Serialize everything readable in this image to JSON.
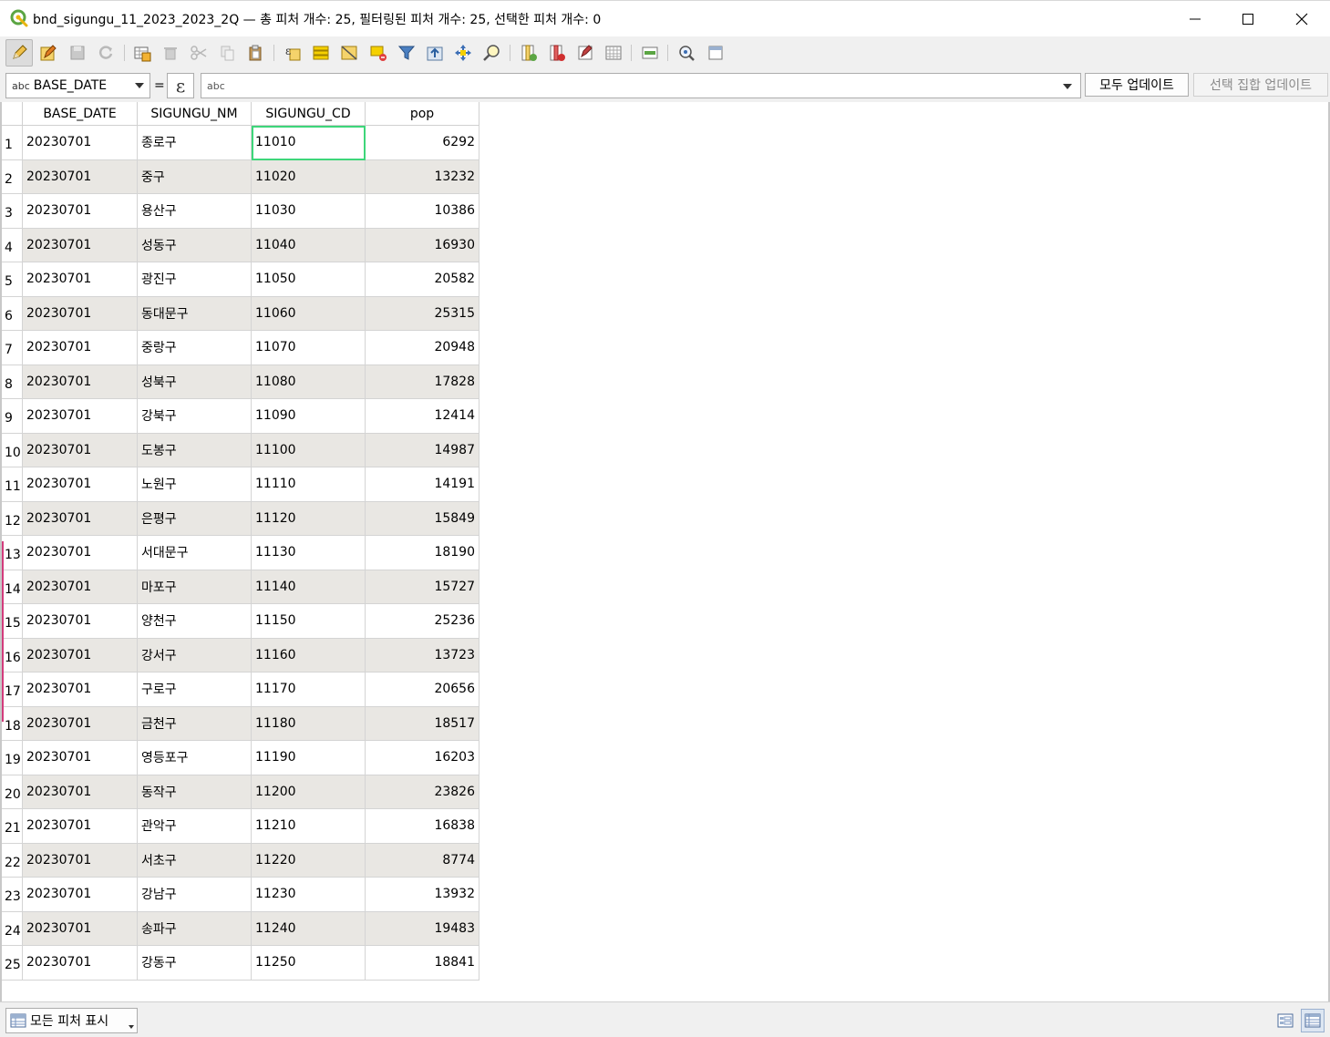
{
  "window": {
    "title": "bnd_sigungu_11_2023_2023_2Q — 총 피처 개수: 25, 필터링된 피처 개수: 25, 선택한 피처 개수: 0"
  },
  "toolbar": {
    "buttons": [
      "toggle-editing-icon",
      "multi-edit-icon",
      "save-edits-icon",
      "reload-icon",
      "add-feature-icon",
      "delete-selected-icon",
      "cut-icon",
      "copy-icon",
      "paste-icon",
      "select-expression-icon",
      "select-all-icon",
      "invert-selection-icon",
      "deselect-all-icon",
      "filter-icon",
      "move-selection-top-icon",
      "pan-to-selected-icon",
      "zoom-to-selected-icon",
      "new-field-icon",
      "delete-field-icon",
      "field-calculator-icon",
      "conditional-formatting-icon",
      "actions-icon",
      "dock-icon",
      "organize-columns-icon"
    ]
  },
  "calc": {
    "field_type": "abc",
    "field": "BASE_DATE",
    "equals": "=",
    "epsilon": "ε",
    "placeholder": "abc",
    "update_all": "모두 업데이트",
    "update_selected": "선택 집합 업데이트"
  },
  "table": {
    "columns": [
      "BASE_DATE",
      "SIGUNGU_NM",
      "SIGUNGU_CD",
      "pop"
    ],
    "rows": [
      [
        "1",
        "20230701",
        "종로구",
        "11010",
        "6292"
      ],
      [
        "2",
        "20230701",
        "중구",
        "11020",
        "13232"
      ],
      [
        "3",
        "20230701",
        "용산구",
        "11030",
        "10386"
      ],
      [
        "4",
        "20230701",
        "성동구",
        "11040",
        "16930"
      ],
      [
        "5",
        "20230701",
        "광진구",
        "11050",
        "20582"
      ],
      [
        "6",
        "20230701",
        "동대문구",
        "11060",
        "25315"
      ],
      [
        "7",
        "20230701",
        "중랑구",
        "11070",
        "20948"
      ],
      [
        "8",
        "20230701",
        "성북구",
        "11080",
        "17828"
      ],
      [
        "9",
        "20230701",
        "강북구",
        "11090",
        "12414"
      ],
      [
        "10",
        "20230701",
        "도봉구",
        "11100",
        "14987"
      ],
      [
        "11",
        "20230701",
        "노원구",
        "11110",
        "14191"
      ],
      [
        "12",
        "20230701",
        "은평구",
        "11120",
        "15849"
      ],
      [
        "13",
        "20230701",
        "서대문구",
        "11130",
        "18190"
      ],
      [
        "14",
        "20230701",
        "마포구",
        "11140",
        "15727"
      ],
      [
        "15",
        "20230701",
        "양천구",
        "11150",
        "25236"
      ],
      [
        "16",
        "20230701",
        "강서구",
        "11160",
        "13723"
      ],
      [
        "17",
        "20230701",
        "구로구",
        "11170",
        "20656"
      ],
      [
        "18",
        "20230701",
        "금천구",
        "11180",
        "18517"
      ],
      [
        "19",
        "20230701",
        "영등포구",
        "11190",
        "16203"
      ],
      [
        "20",
        "20230701",
        "동작구",
        "11200",
        "23826"
      ],
      [
        "21",
        "20230701",
        "관악구",
        "11210",
        "16838"
      ],
      [
        "22",
        "20230701",
        "서초구",
        "11220",
        "8774"
      ],
      [
        "23",
        "20230701",
        "강남구",
        "11230",
        "13932"
      ],
      [
        "24",
        "20230701",
        "송파구",
        "11240",
        "19483"
      ],
      [
        "25",
        "20230701",
        "강동구",
        "11250",
        "18841"
      ]
    ]
  },
  "bottom": {
    "show_all": "모든 피처 표시"
  },
  "colors": {
    "accent_current_cell": "#3ed67a",
    "alt_row": "#e9e7e3",
    "qgis_green": "#5ba543"
  }
}
